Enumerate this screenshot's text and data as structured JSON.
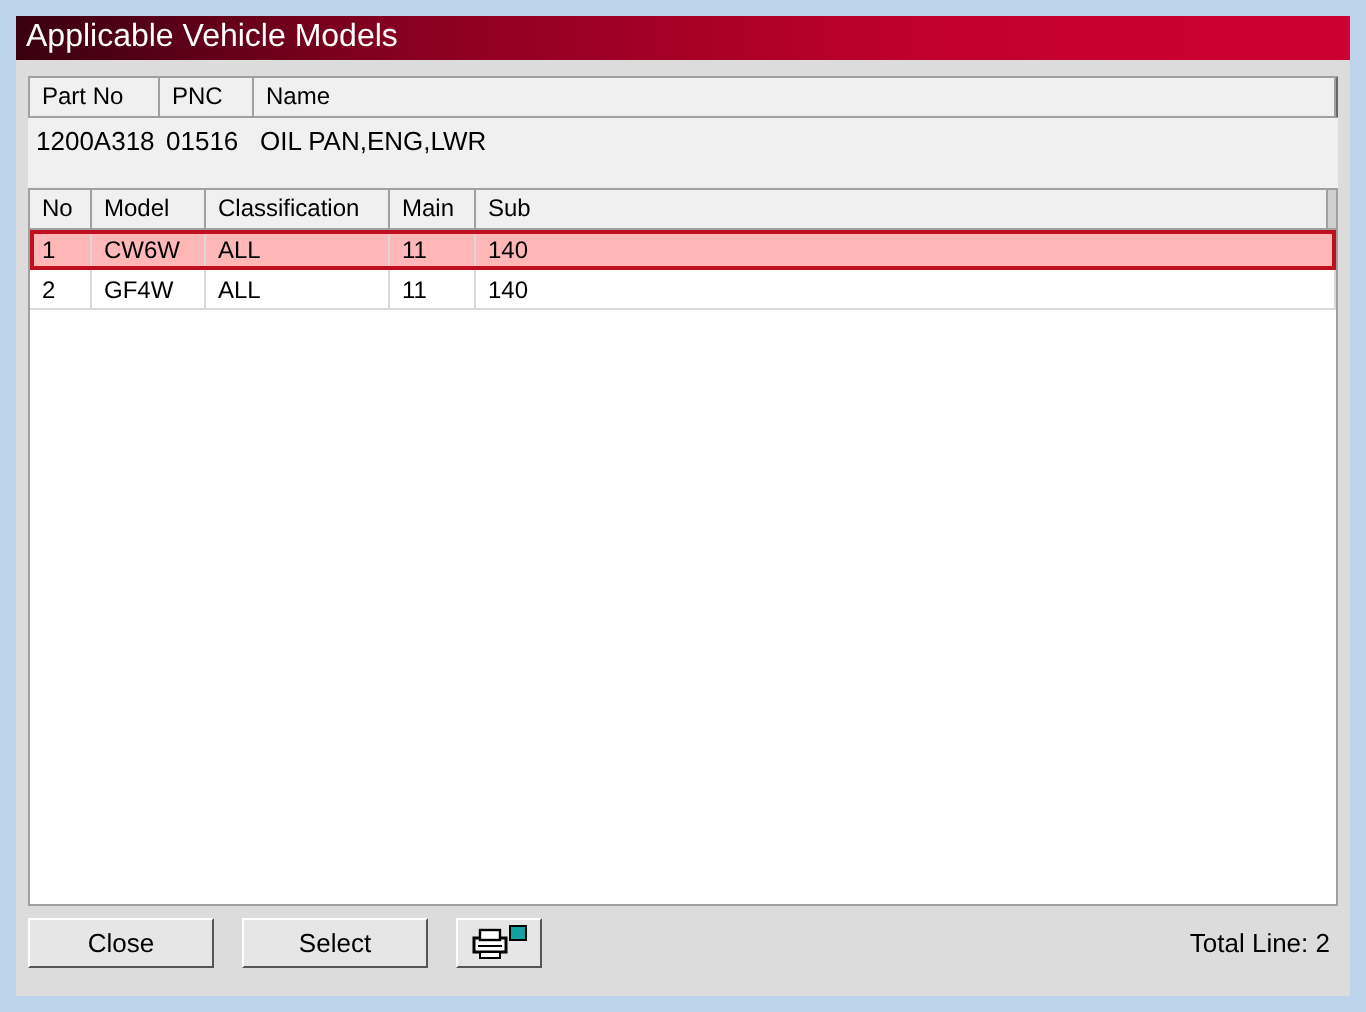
{
  "window": {
    "title": "Applicable Vehicle Models"
  },
  "part": {
    "columns": [
      "Part No",
      "PNC",
      "Name"
    ],
    "values": [
      "1200A318",
      "01516",
      "OIL PAN,ENG,LWR"
    ]
  },
  "table": {
    "columns": [
      "No",
      "Model",
      "Classification",
      "Main",
      "Sub"
    ],
    "rows": [
      {
        "cells": [
          "1",
          "CW6W",
          "ALL",
          "11",
          "140"
        ],
        "selected": true
      },
      {
        "cells": [
          "2",
          "GF4W",
          "ALL",
          "11",
          "140"
        ],
        "selected": false
      }
    ]
  },
  "buttons": [
    "Close",
    "Select"
  ],
  "status": "Total Line: 2"
}
